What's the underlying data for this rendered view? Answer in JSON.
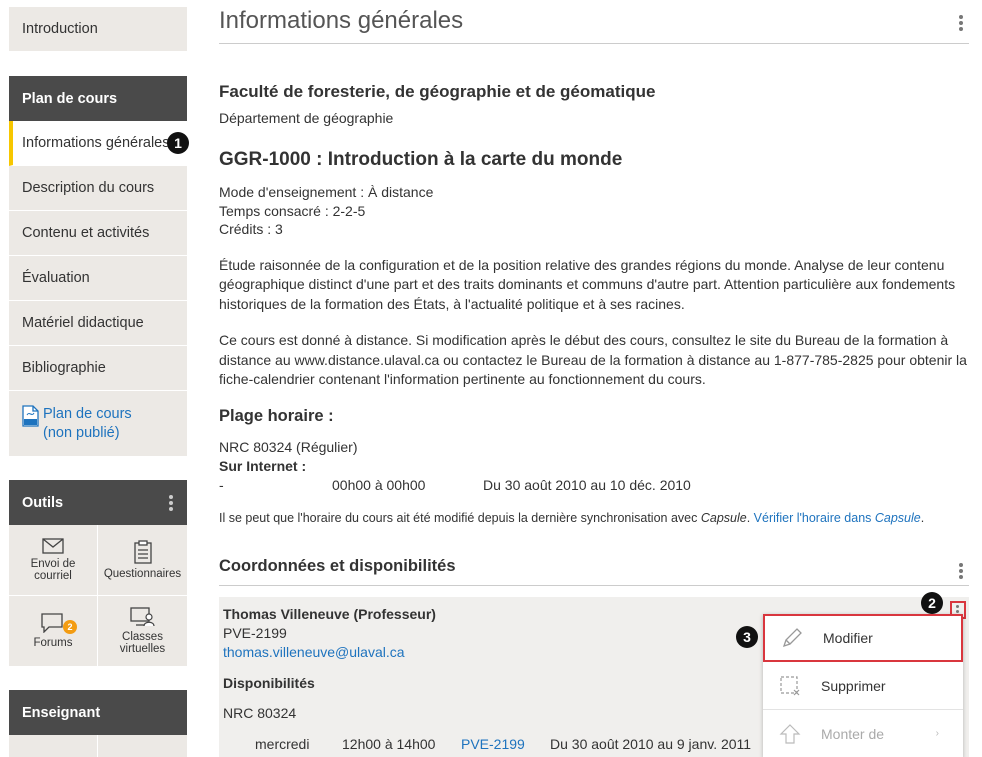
{
  "sidebar": {
    "intro": "Introduction",
    "plan_header": "Plan de cours",
    "plan_items": [
      "Informations générales",
      "Description du cours",
      "Contenu et activités",
      "Évaluation",
      "Matériel didactique",
      "Bibliographie"
    ],
    "plan_pdf_line1": "Plan de cours",
    "plan_pdf_line2": "(non publié)",
    "tools_header": "Outils",
    "tools": [
      {
        "line1": "Envoi de",
        "line2": "courriel",
        "icon": "mail-icon"
      },
      {
        "line1": "Questionnaires",
        "line2": "",
        "icon": "clipboard-icon"
      },
      {
        "line1": "Forums",
        "line2": "",
        "icon": "chat-icon",
        "badge": "2"
      },
      {
        "line1": "Classes",
        "line2": "virtuelles",
        "icon": "virtual-class-icon"
      }
    ],
    "teacher_header": "Enseignant"
  },
  "callouts": {
    "one": "1",
    "two": "2",
    "three": "3"
  },
  "main": {
    "title": "Informations générales",
    "faculty": "Faculté de foresterie, de géographie et de géomatique",
    "department": "Département de géographie",
    "course_title": "GGR-1000 : Introduction à la carte du monde",
    "mode": "Mode d'enseignement : À distance",
    "time": "Temps consacré : 2-2-5",
    "credits": "Crédits : 3",
    "description": "Étude raisonnée de la configuration et de la position relative des grandes régions du monde. Analyse de leur contenu géographique distinct d'une part et des traits dominants et communs d'autre part. Attention particulière aux fondements historiques de la formation des États, à l'actualité politique et à ses racines.",
    "distance_note": "Ce cours est donné à distance. Si modification après le début des cours, consultez le site du Bureau de la formation à distance au www.distance.ulaval.ca ou contactez le Bureau de la formation à distance au 1-877-785-2825 pour obtenir la fiche-calendrier contenant l'information pertinente au fonctionnement du cours.",
    "schedule_title": "Plage horaire :",
    "nrc": "NRC 80324 (Régulier)",
    "internet_label": "Sur Internet :",
    "sched_dash": "-",
    "sched_time": "00h00 à 00h00",
    "sched_dates": "Du 30 août 2010 au 10 déc. 2010",
    "note_prefix": "Il se peut que l'horaire du cours ait été modifié depuis la dernière synchronisation avec ",
    "note_capsule": "Capsule",
    "note_period": ". ",
    "note_link": "Vérifier l'horaire dans ",
    "note_link_capsule": "Capsule",
    "note_end": ".",
    "contacts_title": "Coordonnées et disponibilités",
    "person_name": "Thomas Villeneuve (Professeur)",
    "person_office": "PVE-2199",
    "person_email": "thomas.villeneuve@ulaval.ca",
    "availability_label": "Disponibilités",
    "avail_nrc": "NRC 80324",
    "avail_day": "mercredi",
    "avail_time": "12h00 à 14h00",
    "avail_room": "PVE-2199",
    "avail_dates": "Du 30 août 2010 au 9 janv. 2011"
  },
  "menu": {
    "modify": "Modifier",
    "delete": "Supprimer",
    "move_up": "Monter de"
  },
  "colors": {
    "accent_yellow": "#f7c700",
    "link_blue": "#1e73be",
    "header_dark": "#4a4a4a",
    "highlight_red": "#d9363e",
    "badge_orange": "#f39c12"
  }
}
